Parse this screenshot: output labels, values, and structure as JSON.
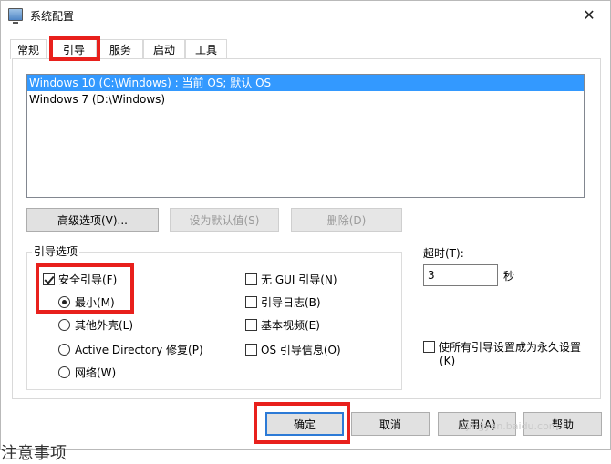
{
  "window": {
    "title": "系统配置",
    "close_glyph": "✕"
  },
  "tabs": [
    {
      "label": "常规"
    },
    {
      "label": "引导"
    },
    {
      "label": "服务"
    },
    {
      "label": "启动"
    },
    {
      "label": "工具"
    }
  ],
  "os_list": [
    {
      "text": "Windows 10 (C:\\Windows) : 当前 OS; 默认 OS",
      "selected": true
    },
    {
      "text": "Windows 7 (D:\\Windows)",
      "selected": false
    }
  ],
  "buttons": {
    "advanced": "高级选项(V)...",
    "set_default": "设为默认值(S)",
    "delete": "删除(D)"
  },
  "boot_options": {
    "title": "引导选项",
    "safe_boot": "安全引导(F)",
    "minimal": "最小(M)",
    "alternate_shell": "其他外壳(L)",
    "ad_repair": "Active Directory 修复(P)",
    "network": "网络(W)",
    "no_gui": "无 GUI 引导(N)",
    "boot_log": "引导日志(B)",
    "base_video": "基本视频(E)",
    "os_boot_info": "OS 引导信息(O)"
  },
  "timeout": {
    "label": "超时(T):",
    "value": "3",
    "unit": "秒"
  },
  "permanent": {
    "line1": "使所有引导设置成为永久设置",
    "line2": "(K)"
  },
  "dialog_buttons": {
    "ok": "确定",
    "cancel": "取消",
    "apply": "应用(A)",
    "help": "帮助"
  },
  "watermark": "jingyan.baidu.com",
  "cut_text": "注意事项",
  "colors": {
    "highlight": "#e8201c",
    "selection": "#3399ff"
  }
}
